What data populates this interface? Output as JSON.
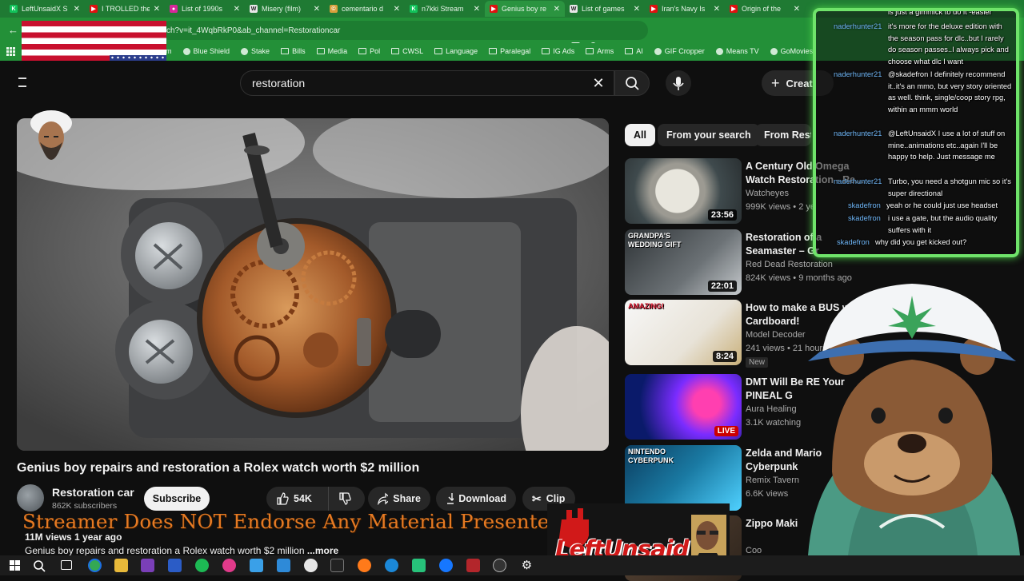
{
  "browser": {
    "tabs": [
      {
        "title": "LeftUnsaidX S",
        "color": "#12c25a",
        "glyph": "K"
      },
      {
        "title": "I TROLLED the",
        "color": "#e01010",
        "glyph": "▶"
      },
      {
        "title": "List of 1990s",
        "color": "#d6279a",
        "glyph": "●"
      },
      {
        "title": "Misery (film)",
        "color": "#e8e8e8",
        "glyph": "W"
      },
      {
        "title": "cementario d",
        "color": "#d9a03c",
        "glyph": "©"
      },
      {
        "title": "n7kki Stream",
        "color": "#12c25a",
        "glyph": "K"
      },
      {
        "title": "Genius boy re",
        "color": "#e01010",
        "glyph": "▶"
      },
      {
        "title": "List of games",
        "color": "#e8e8e8",
        "glyph": "W"
      },
      {
        "title": "Iran's Navy Is",
        "color": "#e01010",
        "glyph": "▶"
      },
      {
        "title": "Origin of the",
        "color": "#e01010",
        "glyph": "▶"
      }
    ],
    "active_tab_index": 6,
    "url": "ch?v=it_4WqbRkP0&ab_channel=Restorationcar",
    "bookmarks": [
      {
        "label": "m",
        "type": "text"
      },
      {
        "label": "Blue Shield",
        "type": "site"
      },
      {
        "label": "Stake",
        "type": "site"
      },
      {
        "label": "Bills",
        "type": "folder"
      },
      {
        "label": "Media",
        "type": "folder"
      },
      {
        "label": "Pol",
        "type": "folder"
      },
      {
        "label": "CWSL",
        "type": "folder"
      },
      {
        "label": "Language",
        "type": "folder"
      },
      {
        "label": "Paralegal",
        "type": "folder"
      },
      {
        "label": "IG Ads",
        "type": "folder"
      },
      {
        "label": "Arms",
        "type": "folder"
      },
      {
        "label": "AI",
        "type": "folder"
      },
      {
        "label": "GIF Cropper",
        "type": "site"
      },
      {
        "label": "Means TV",
        "type": "site"
      },
      {
        "label": "GoMovies",
        "type": "site"
      }
    ]
  },
  "youtube": {
    "search_query": "restoration",
    "create_label": "Creat",
    "video": {
      "title": "Genius boy repairs and restoration a Rolex watch worth $2 million",
      "channel": "Restoration car",
      "subscribers": "862K subscribers",
      "subscribe_label": "Subscribe",
      "likes": "54K",
      "share_label": "Share",
      "download_label": "Download",
      "clip_label": "Clip",
      "views_age": "11M views  1 year ago",
      "description": "Genius boy repairs and restoration a Rolex watch worth $2 million",
      "more_label": "...more"
    },
    "chips": [
      "All",
      "From your search",
      "From Restoration car"
    ],
    "recommendations": [
      {
        "title": "A Century Old Omega Watch Restoration - Re...",
        "channel": "Watcheyes",
        "meta": "999K views • 2 ye",
        "duration": "23:56",
        "thumb": "watch"
      },
      {
        "title": "Restoration of a Seamaster – Gr",
        "channel": "Red Dead Restoration",
        "meta": "824K views • 9 months ago",
        "duration": "22:01",
        "thumb": "grandpa",
        "thumb_text": "GRANDPA'S WEDDING GIFT"
      },
      {
        "title": "How to make a BUS with Cardboard!",
        "channel": "Model Decoder",
        "meta": "241 views • 21 hours",
        "duration": "8:24",
        "thumb": "bus",
        "thumb_text": "AMAZING!",
        "badge": "New"
      },
      {
        "title": "DMT Will Be RE Your PINEAL G",
        "channel": "Aura Healing",
        "meta": "3.1K watching",
        "live": "LIVE",
        "thumb": "dmt"
      },
      {
        "title": "Zelda and Mario Cyberpunk",
        "channel": "Remix Tavern",
        "meta": "6.6K views",
        "thumb": "zelda",
        "thumb_text": "NINTENDO CYBERPUNK"
      },
      {
        "title": "Zippo Maki",
        "channel": "Coo",
        "meta": "",
        "thumb": "zippo"
      }
    ]
  },
  "chat": {
    "messages": [
      {
        "user": "",
        "text": "is just a gimmick to do it -easier"
      },
      {
        "user": "naderhunter21",
        "text": "it's more for the deluxe edition with the season pass for dlc..but I rarely do season passes..I always pick and choose what dlc I want"
      },
      {
        "user": "naderhunter21",
        "text": "@skadefron I definitely recommend it..it's an mmo, but very story oriented as well. think, single/coop story rpg, within an mmm world"
      },
      {
        "user": "naderhunter21",
        "text": "@LeftUnsaidX I use a lot of stuff on mine..animations etc..again I'll be happy to help. Just message me"
      },
      {
        "user": "naderhunter21",
        "text": "Turbo, you need a shotgun mic so it's super directional"
      },
      {
        "user": "skadefron",
        "text": "yeah or he could just use headset"
      },
      {
        "user": "skadefron",
        "text": "i use a gate, but the audio quality suffers with it"
      },
      {
        "user": "skadefron",
        "text": "why did you get kicked out?"
      }
    ]
  },
  "overlay": {
    "disclaimer": "Streamer Does NOT Endorse Any Material Presented",
    "logo_text": "LeftUnsaid"
  },
  "colors": {
    "chrome_green": "#239038",
    "chat_border": "#6fe36a",
    "disclaimer": "#e57a23",
    "logo_red": "#d11919"
  }
}
